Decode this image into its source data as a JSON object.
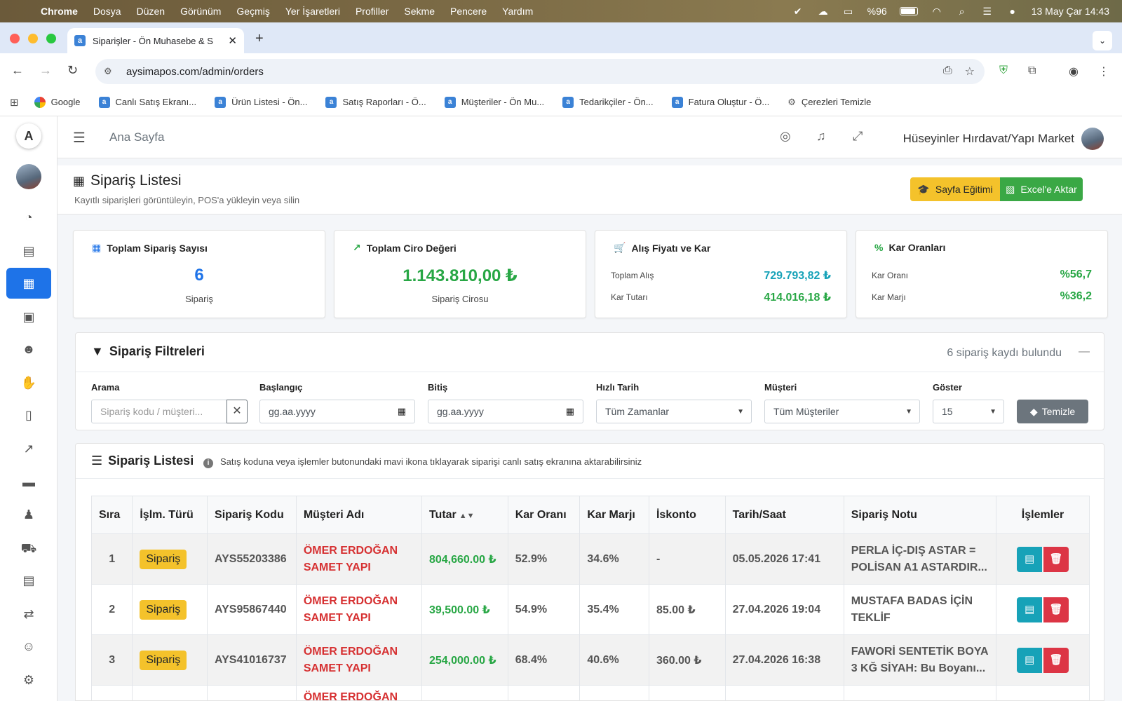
{
  "os_menu": {
    "app": "Chrome",
    "items": [
      "Dosya",
      "Düzen",
      "Görünüm",
      "Geçmiş",
      "Yer İşaretleri",
      "Profiller",
      "Sekme",
      "Pencere",
      "Yardım"
    ],
    "battery": "%96",
    "datetime": "13 May Çar  14:43"
  },
  "browser": {
    "tab_title": "Siparişler - Ön Muhasebe & S",
    "url": "aysimapos.com/admin/orders",
    "bookmarks": [
      "Google",
      "Canlı Satış Ekranı...",
      "Ürün Listesi - Ön...",
      "Satış Raporları - Ö...",
      "Müşteriler - Ön Mu...",
      "Tedarikçiler - Ön...",
      "Fatura Oluştur - Ö...",
      "Çerezleri Temizle"
    ]
  },
  "header": {
    "breadcrumb": "Ana Sayfa",
    "company": "Hüseyinler Hırdavat/Yapı Market"
  },
  "page": {
    "title": "Sipariş Listesi",
    "subtitle": "Kayıtlı siparişleri görüntüleyin, POS'a yükleyin veya silin",
    "btn_training": "Sayfa Eğitimi",
    "btn_excel": "Excel'e Aktar"
  },
  "stats": {
    "orders": {
      "title": "Toplam Sipariş Sayısı",
      "value": "6",
      "sub": "Sipariş"
    },
    "revenue": {
      "title": "Toplam Ciro Değeri",
      "value": "1.143.810,00 ₺",
      "sub": "Sipariş Cirosu"
    },
    "cost": {
      "title": "Alış Fiyatı ve Kar",
      "l1": "Toplam Alış",
      "v1": "729.793,82 ₺",
      "l2": "Kar Tutarı",
      "v2": "414.016,18 ₺"
    },
    "ratio": {
      "title": "Kar Oranları",
      "l1": "Kar Oranı",
      "v1": "%56,7",
      "l2": "Kar Marjı",
      "v2": "%36,2"
    }
  },
  "filters": {
    "title": "Sipariş Filtreleri",
    "count": "6 sipariş kaydı bulundu",
    "search_label": "Arama",
    "search_placeholder": "Sipariş kodu / müşteri...",
    "start_label": "Başlangıç",
    "start_value": "gg.aa.yyyy",
    "end_label": "Bitiş",
    "end_value": "gg.aa.yyyy",
    "quick_label": "Hızlı Tarih",
    "quick_value": "Tüm Zamanlar",
    "customer_label": "Müşteri",
    "customer_value": "Tüm Müşteriler",
    "show_label": "Göster",
    "show_value": "15",
    "clear_button": "Temizle"
  },
  "list": {
    "title": "Sipariş Listesi",
    "info": "Satış koduna veya işlemler butonundaki mavi ikona tıklayarak siparişi canlı satış ekranına aktarabilirsiniz",
    "columns": [
      "Sıra",
      "İşlm. Türü",
      "Sipariş Kodu",
      "Müşteri Adı",
      "Tutar",
      "Kar Oranı",
      "Kar Marjı",
      "İskonto",
      "Tarih/Saat",
      "Sipariş Notu",
      "İşlemler"
    ],
    "rows": [
      {
        "no": "1",
        "type": "Sipariş",
        "code": "AYS55203386",
        "customer": "ÖMER ERDOĞAN SAMET YAPI",
        "amount": "804,660.00 ₺",
        "ratio": "52.9%",
        "margin": "34.6%",
        "discount": "-",
        "date": "05.05.2026 17:41",
        "note": "PERLA İÇ-DIŞ ASTAR = POLİSAN A1 ASTARDIR..."
      },
      {
        "no": "2",
        "type": "Sipariş",
        "code": "AYS95867440",
        "customer": "ÖMER ERDOĞAN SAMET YAPI",
        "amount": "39,500.00 ₺",
        "ratio": "54.9%",
        "margin": "35.4%",
        "discount": "85.00 ₺",
        "date": "27.04.2026 19:04",
        "note": "MUSTAFA BADAS İÇİN TEKLİF"
      },
      {
        "no": "3",
        "type": "Sipariş",
        "code": "AYS41016737",
        "customer": "ÖMER ERDOĞAN SAMET YAPI",
        "amount": "254,000.00 ₺",
        "ratio": "68.4%",
        "margin": "40.6%",
        "discount": "360.00 ₺",
        "date": "27.04.2026 16:38",
        "note": "FAWORİ SENTETİK BOYA 3 KĞ SİYAH: Bu Boyanı..."
      },
      {
        "no": "",
        "type": "",
        "code": "",
        "customer": "ÖMER ERDOĞAN",
        "amount": "",
        "ratio": "",
        "margin": "",
        "discount": "",
        "date": "",
        "note": ""
      }
    ]
  }
}
